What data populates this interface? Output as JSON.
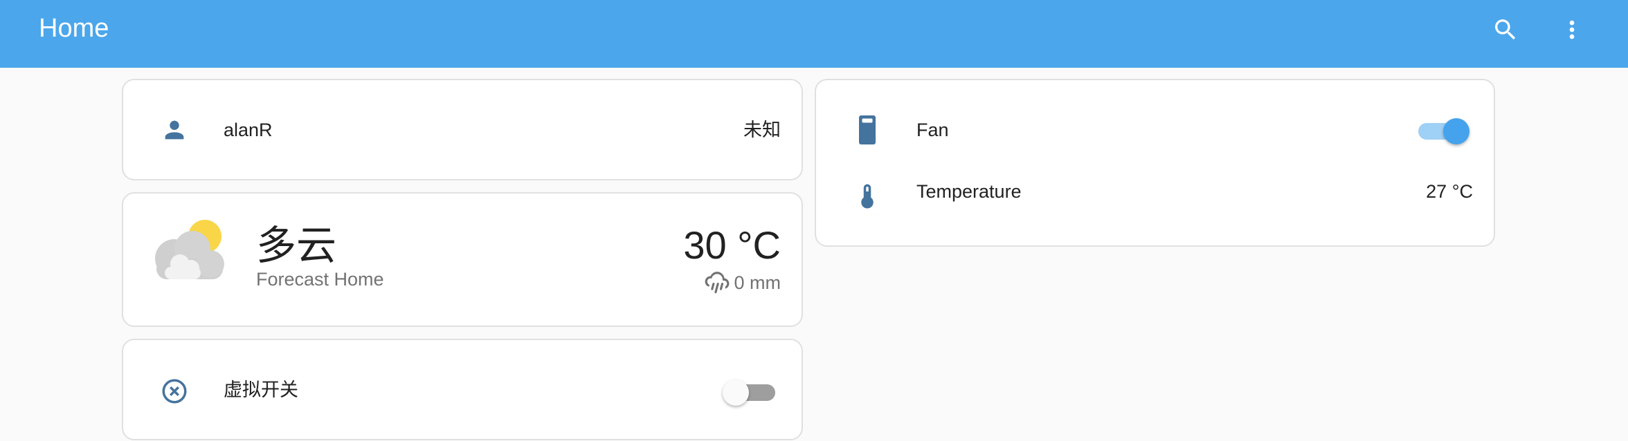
{
  "header": {
    "title": "Home",
    "search_icon": "search-icon",
    "menu_icon": "more-vertical-icon"
  },
  "colors": {
    "header_bg": "#4ba6eb",
    "state_icon": "#44739e",
    "toggle_on": "#44a3ec"
  },
  "person_card": {
    "icon": "account-icon",
    "name": "alanR",
    "state": "未知"
  },
  "weather_card": {
    "icon": "partly-cloudy-icon",
    "condition": "多云",
    "name": "Forecast Home",
    "temperature": "30 °C",
    "precip_icon": "rain-cloud-icon",
    "precipitation": "0 mm"
  },
  "switch_card": {
    "icon": "close-circle-icon",
    "name": "虚拟开关",
    "is_on": false
  },
  "entities_card": {
    "rows": [
      {
        "icon": "fan-device-icon",
        "name": "Fan",
        "is_on": true
      },
      {
        "icon": "thermometer-icon",
        "name": "Temperature",
        "value": "27 °C"
      }
    ]
  }
}
